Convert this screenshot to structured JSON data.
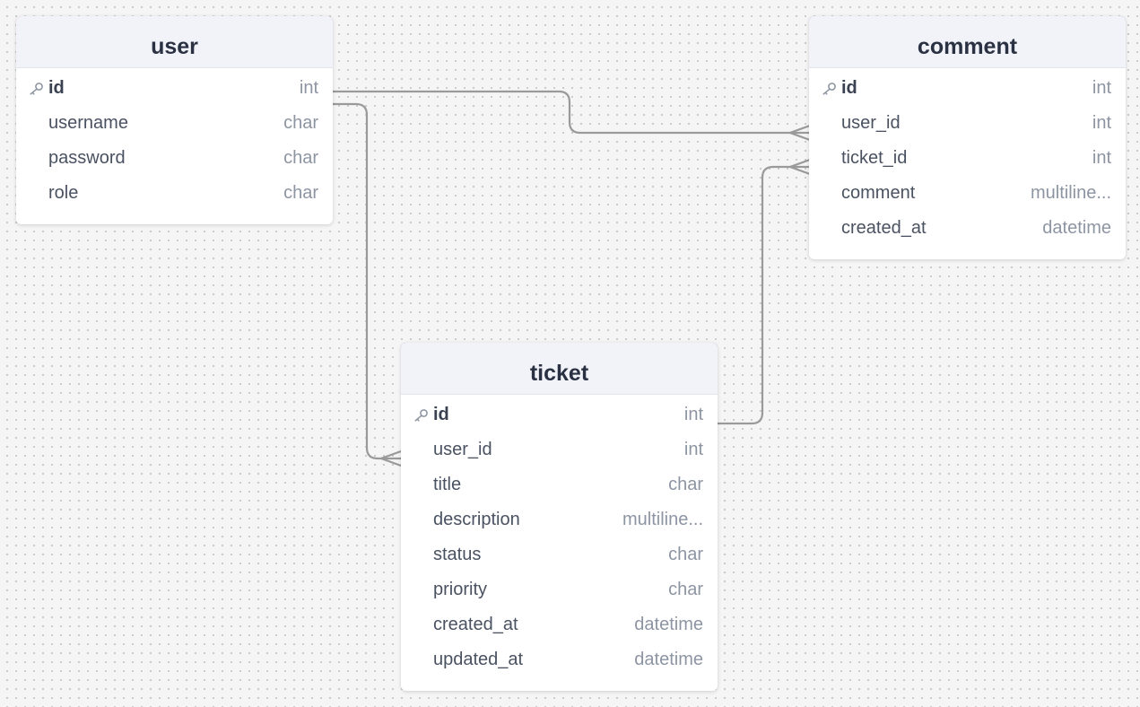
{
  "tables": {
    "user": {
      "name": "user",
      "accent": "#f2709c",
      "fields": [
        {
          "name": "id",
          "type": "int",
          "pk": true
        },
        {
          "name": "username",
          "type": "char",
          "pk": false
        },
        {
          "name": "password",
          "type": "char",
          "pk": false
        },
        {
          "name": "role",
          "type": "char",
          "pk": false
        }
      ]
    },
    "comment": {
      "name": "comment",
      "accent": "#6573d1",
      "fields": [
        {
          "name": "id",
          "type": "int",
          "pk": true
        },
        {
          "name": "user_id",
          "type": "int",
          "pk": false
        },
        {
          "name": "ticket_id",
          "type": "int",
          "pk": false
        },
        {
          "name": "comment",
          "type": "multiline...",
          "pk": false
        },
        {
          "name": "created_at",
          "type": "datetime",
          "pk": false
        }
      ]
    },
    "ticket": {
      "name": "ticket",
      "accent": "#905ee0",
      "fields": [
        {
          "name": "id",
          "type": "int",
          "pk": true
        },
        {
          "name": "user_id",
          "type": "int",
          "pk": false
        },
        {
          "name": "title",
          "type": "char",
          "pk": false
        },
        {
          "name": "description",
          "type": "multiline...",
          "pk": false
        },
        {
          "name": "status",
          "type": "char",
          "pk": false
        },
        {
          "name": "priority",
          "type": "char",
          "pk": false
        },
        {
          "name": "created_at",
          "type": "datetime",
          "pk": false
        },
        {
          "name": "updated_at",
          "type": "datetime",
          "pk": false
        }
      ]
    }
  },
  "relations": [
    {
      "from": "user.id",
      "to": "comment.user_id",
      "cardinality": "one-to-many"
    },
    {
      "from": "user.id",
      "to": "ticket.user_id",
      "cardinality": "one-to-many"
    },
    {
      "from": "ticket.id",
      "to": "comment.ticket_id",
      "cardinality": "one-to-many"
    }
  ],
  "icons": {
    "primary_key": "key-icon"
  },
  "colors": {
    "connector": "#9a9a9a",
    "key_icon": "#8b93a0"
  }
}
